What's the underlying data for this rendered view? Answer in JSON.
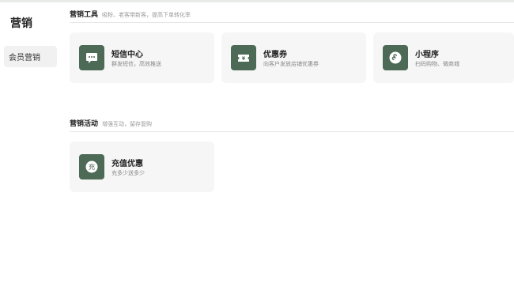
{
  "sidebar": {
    "title": "营销",
    "items": [
      {
        "label": "会员营销"
      }
    ]
  },
  "sections": [
    {
      "title": "营销工具",
      "description": "吸粉、老客带新客，提高下单转化率",
      "cards": [
        {
          "title": "短信中心",
          "description": "群发短信，高效推送",
          "icon": "message-icon"
        },
        {
          "title": "优惠券",
          "description": "向客户发放店铺优惠券",
          "icon": "coupon-icon"
        },
        {
          "title": "小程序",
          "description": "扫码购物、微商城",
          "icon": "miniprogram-icon"
        }
      ]
    },
    {
      "title": "营销活动",
      "description": "增强互动，留存复购",
      "cards": [
        {
          "title": "充值优惠",
          "description": "充多少送多少",
          "icon": "recharge-icon"
        }
      ]
    }
  ],
  "colors": {
    "accent": "#4c6a55",
    "card_bg": "#f5f6f5",
    "sidebar_active_bg": "#f0f1f0"
  }
}
